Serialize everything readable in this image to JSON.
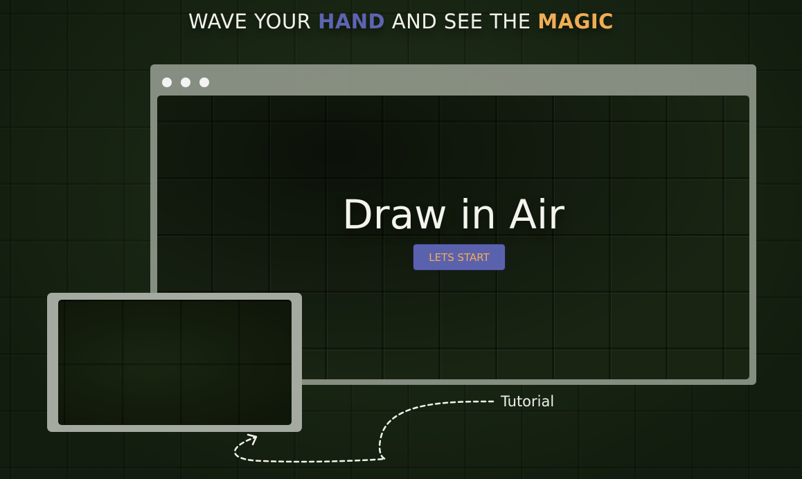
{
  "headline": {
    "part1": "WAVE YOUR ",
    "highlight1": "HAND",
    "part2": " AND SEE THE ",
    "highlight2": "MAGIC"
  },
  "browser": {
    "title": "Draw in Air",
    "start_button_label": "LETS START"
  },
  "tutorial": {
    "label": "Tutorial"
  },
  "icons": {
    "window_dots": [
      "window-dot-icon",
      "window-dot-icon",
      "window-dot-icon"
    ],
    "arrow": "curved-dashed-arrow-icon"
  },
  "colors": {
    "background": "#1d2a17",
    "hand_highlight": "#5d64b0",
    "magic_highlight": "#f0ad55",
    "button_bg": "#5b62ad",
    "button_text": "#f1ad57",
    "frame": "#a4aaa0"
  }
}
